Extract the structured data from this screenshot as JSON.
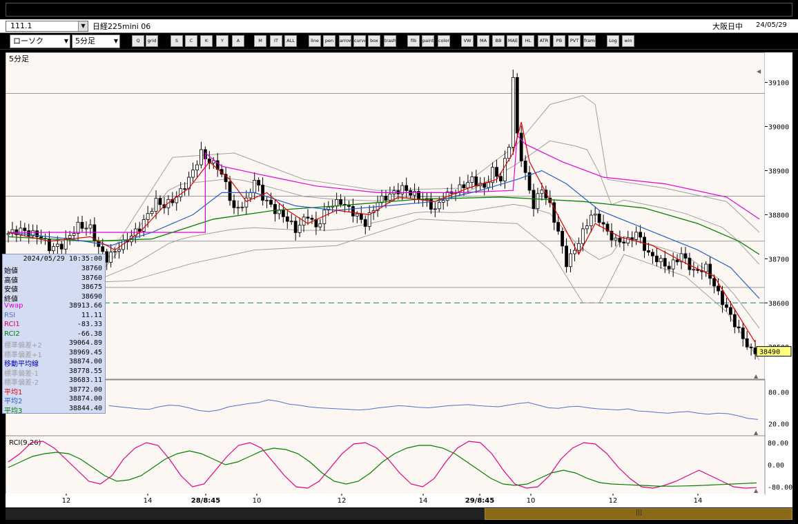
{
  "header": {
    "symbol_code": "111.1",
    "instrument_name": "日経225mini 06",
    "session": "大阪日中",
    "date": "24/05/29"
  },
  "toolbar": {
    "chart_type": "ローソク",
    "interval": "5分足",
    "buttons": [
      "Q",
      "grid",
      "S",
      "C",
      "K",
      "Y",
      "A",
      "M",
      "IT",
      "ALL",
      "line",
      "pen",
      "arrow",
      "curve",
      "box",
      "trash",
      "fib",
      "paint",
      "color",
      "VW",
      "MA",
      "BB",
      "MAE",
      "HL",
      "ATR",
      "PB",
      "PVT",
      "frame",
      "Log",
      "win"
    ]
  },
  "main_panel": {
    "interval_label": "5分足",
    "price_levels": [
      "39100",
      "39000",
      "38900",
      "38800",
      "38700",
      "38600",
      "38500"
    ],
    "last_price_badge": "38490"
  },
  "info_box": {
    "timestamp": "2024/05/29  10:35:00",
    "rows": [
      {
        "label": "始値",
        "value": "38760",
        "color": "#000"
      },
      {
        "label": "高値",
        "value": "38760",
        "color": "#000"
      },
      {
        "label": "安値",
        "value": "38675",
        "color": "#000"
      },
      {
        "label": "終値",
        "value": "38690",
        "color": "#000"
      },
      {
        "label": "Vwap",
        "value": "38913.66",
        "color": "#e000e0"
      },
      {
        "label": "RSI",
        "value": "11.11",
        "color": "#5070d0"
      },
      {
        "label": "RCI1",
        "value": "-83.33",
        "color": "#e00060"
      },
      {
        "label": "RCI2",
        "value": "-66.38",
        "color": "#008000"
      },
      {
        "label": "標準偏差+2",
        "value": "39064.89",
        "color": "#a0a0a0"
      },
      {
        "label": "標準偏差+1",
        "value": "38969.45",
        "color": "#a0a0a0"
      },
      {
        "label": "移動平均線",
        "value": "38874.00",
        "color": "#0000c0"
      },
      {
        "label": "標準偏差-1",
        "value": "38778.55",
        "color": "#a0a0a0"
      },
      {
        "label": "標準偏差-2",
        "value": "38683.11",
        "color": "#a0a0a0"
      },
      {
        "label": "平均1",
        "value": "38772.00",
        "color": "#e00000"
      },
      {
        "label": "平均2",
        "value": "38874.00",
        "color": "#2060d0"
      },
      {
        "label": "平均3",
        "value": "38844.40",
        "color": "#008000"
      }
    ]
  },
  "rsi_panel": {
    "levels": [
      "80.00",
      "20.00"
    ]
  },
  "rci_panel": {
    "label": "RCI(9,26)",
    "levels": [
      "80.00",
      "0.00",
      "-80.00"
    ]
  },
  "x_axis": [
    "12",
    "14",
    "28/8:45",
    "10",
    "12",
    "14",
    "29/8:45",
    "10",
    "12",
    "14"
  ],
  "colors": {
    "background": "#fdf7f3",
    "candle_up": "#ffffff",
    "candle_down": "#000000",
    "ma_short": "#e00000",
    "ma_mid": "#2060d0",
    "ma_long": "#008000",
    "vwap": "#e000e0",
    "bands": "#a0a0a0",
    "rci_fast": "#e00080",
    "rci_slow": "#008000",
    "rsi": "#5070d0"
  },
  "chart_data": {
    "type": "candlestick",
    "title": "",
    "ylim": [
      38430,
      39165
    ],
    "yticks": [
      39100,
      39000,
      38900,
      38800,
      38700,
      38600,
      38500
    ],
    "dashed_level": 38600,
    "last_price": 38490,
    "close_path": [
      {
        "x": 0,
        "y": 38755
      },
      {
        "x": 4,
        "y": 38765
      },
      {
        "x": 9,
        "y": 38750
      },
      {
        "x": 11,
        "y": 38725
      },
      {
        "x": 14,
        "y": 38730
      },
      {
        "x": 18,
        "y": 38775
      },
      {
        "x": 21,
        "y": 38770
      },
      {
        "x": 23,
        "y": 38725
      },
      {
        "x": 25,
        "y": 38700
      },
      {
        "x": 29,
        "y": 38735
      },
      {
        "x": 33,
        "y": 38770
      },
      {
        "x": 37,
        "y": 38830
      },
      {
        "x": 39,
        "y": 38820
      },
      {
        "x": 42,
        "y": 38840
      },
      {
        "x": 45,
        "y": 38880
      },
      {
        "x": 48,
        "y": 38940
      },
      {
        "x": 50,
        "y": 38920
      },
      {
        "x": 52,
        "y": 38910
      },
      {
        "x": 54,
        "y": 38870
      },
      {
        "x": 56,
        "y": 38810
      },
      {
        "x": 59,
        "y": 38830
      },
      {
        "x": 61,
        "y": 38880
      },
      {
        "x": 63,
        "y": 38840
      },
      {
        "x": 66,
        "y": 38810
      },
      {
        "x": 69,
        "y": 38790
      },
      {
        "x": 71,
        "y": 38765
      },
      {
        "x": 74,
        "y": 38800
      },
      {
        "x": 76,
        "y": 38770
      },
      {
        "x": 79,
        "y": 38820
      },
      {
        "x": 82,
        "y": 38830
      },
      {
        "x": 85,
        "y": 38805
      },
      {
        "x": 88,
        "y": 38780
      },
      {
        "x": 91,
        "y": 38830
      },
      {
        "x": 94,
        "y": 38845
      },
      {
        "x": 97,
        "y": 38860
      },
      {
        "x": 100,
        "y": 38845
      },
      {
        "x": 103,
        "y": 38830
      },
      {
        "x": 105,
        "y": 38810
      },
      {
        "x": 107,
        "y": 38840
      },
      {
        "x": 111,
        "y": 38860
      },
      {
        "x": 114,
        "y": 38880
      },
      {
        "x": 117,
        "y": 38860
      },
      {
        "x": 119,
        "y": 38900
      },
      {
        "x": 121,
        "y": 38880
      },
      {
        "x": 123,
        "y": 38960
      },
      {
        "x": 124,
        "y": 39110
      },
      {
        "x": 125,
        "y": 38980
      },
      {
        "x": 126,
        "y": 38930
      },
      {
        "x": 127,
        "y": 38890
      },
      {
        "x": 129,
        "y": 38820
      },
      {
        "x": 131,
        "y": 38860
      },
      {
        "x": 133,
        "y": 38820
      },
      {
        "x": 135,
        "y": 38760
      },
      {
        "x": 137,
        "y": 38690
      },
      {
        "x": 139,
        "y": 38720
      },
      {
        "x": 141,
        "y": 38760
      },
      {
        "x": 143,
        "y": 38800
      },
      {
        "x": 145,
        "y": 38790
      },
      {
        "x": 147,
        "y": 38760
      },
      {
        "x": 149,
        "y": 38740
      },
      {
        "x": 152,
        "y": 38740
      },
      {
        "x": 154,
        "y": 38760
      },
      {
        "x": 157,
        "y": 38710
      },
      {
        "x": 159,
        "y": 38700
      },
      {
        "x": 162,
        "y": 38680
      },
      {
        "x": 165,
        "y": 38710
      },
      {
        "x": 168,
        "y": 38670
      },
      {
        "x": 171,
        "y": 38680
      },
      {
        "x": 174,
        "y": 38620
      },
      {
        "x": 177,
        "y": 38570
      },
      {
        "x": 180,
        "y": 38520
      },
      {
        "x": 182,
        "y": 38490
      }
    ],
    "ma_short": [
      {
        "x": 0,
        "y": 38760
      },
      {
        "x": 10,
        "y": 38740
      },
      {
        "x": 20,
        "y": 38750
      },
      {
        "x": 26,
        "y": 38720
      },
      {
        "x": 32,
        "y": 38760
      },
      {
        "x": 38,
        "y": 38820
      },
      {
        "x": 44,
        "y": 38860
      },
      {
        "x": 49,
        "y": 38920
      },
      {
        "x": 54,
        "y": 38880
      },
      {
        "x": 58,
        "y": 38830
      },
      {
        "x": 63,
        "y": 38850
      },
      {
        "x": 68,
        "y": 38810
      },
      {
        "x": 73,
        "y": 38780
      },
      {
        "x": 80,
        "y": 38810
      },
      {
        "x": 88,
        "y": 38800
      },
      {
        "x": 95,
        "y": 38840
      },
      {
        "x": 104,
        "y": 38830
      },
      {
        "x": 112,
        "y": 38860
      },
      {
        "x": 119,
        "y": 38880
      },
      {
        "x": 123,
        "y": 38940
      },
      {
        "x": 125,
        "y": 39010
      },
      {
        "x": 127,
        "y": 38920
      },
      {
        "x": 131,
        "y": 38850
      },
      {
        "x": 135,
        "y": 38780
      },
      {
        "x": 139,
        "y": 38710
      },
      {
        "x": 143,
        "y": 38780
      },
      {
        "x": 149,
        "y": 38750
      },
      {
        "x": 157,
        "y": 38730
      },
      {
        "x": 165,
        "y": 38690
      },
      {
        "x": 172,
        "y": 38660
      },
      {
        "x": 178,
        "y": 38570
      },
      {
        "x": 182,
        "y": 38510
      }
    ],
    "ma_mid": [
      {
        "x": 0,
        "y": 38760
      },
      {
        "x": 15,
        "y": 38745
      },
      {
        "x": 25,
        "y": 38730
      },
      {
        "x": 35,
        "y": 38760
      },
      {
        "x": 45,
        "y": 38800
      },
      {
        "x": 52,
        "y": 38850
      },
      {
        "x": 60,
        "y": 38850
      },
      {
        "x": 70,
        "y": 38820
      },
      {
        "x": 80,
        "y": 38810
      },
      {
        "x": 92,
        "y": 38820
      },
      {
        "x": 104,
        "y": 38830
      },
      {
        "x": 115,
        "y": 38855
      },
      {
        "x": 124,
        "y": 38880
      },
      {
        "x": 130,
        "y": 38900
      },
      {
        "x": 136,
        "y": 38870
      },
      {
        "x": 144,
        "y": 38810
      },
      {
        "x": 152,
        "y": 38780
      },
      {
        "x": 160,
        "y": 38750
      },
      {
        "x": 168,
        "y": 38720
      },
      {
        "x": 176,
        "y": 38680
      },
      {
        "x": 183,
        "y": 38610
      }
    ],
    "ma_long": [
      {
        "x": 0,
        "y": 38750
      },
      {
        "x": 20,
        "y": 38740
      },
      {
        "x": 35,
        "y": 38745
      },
      {
        "x": 50,
        "y": 38790
      },
      {
        "x": 65,
        "y": 38810
      },
      {
        "x": 80,
        "y": 38820
      },
      {
        "x": 100,
        "y": 38835
      },
      {
        "x": 120,
        "y": 38840
      },
      {
        "x": 140,
        "y": 38830
      },
      {
        "x": 155,
        "y": 38815
      },
      {
        "x": 168,
        "y": 38780
      },
      {
        "x": 178,
        "y": 38740
      },
      {
        "x": 183,
        "y": 38710
      }
    ],
    "vwap": [
      {
        "x": 0,
        "y": 38760
      },
      {
        "x": 48,
        "y": 38760
      },
      {
        "x": 48,
        "y": 38940
      },
      {
        "x": 52,
        "y": 38910
      },
      {
        "x": 62,
        "y": 38890
      },
      {
        "x": 75,
        "y": 38865
      },
      {
        "x": 90,
        "y": 38850
      },
      {
        "x": 110,
        "y": 38850
      },
      {
        "x": 123,
        "y": 38855
      },
      {
        "x": 124,
        "y": 38980
      },
      {
        "x": 126,
        "y": 38960
      },
      {
        "x": 135,
        "y": 38920
      },
      {
        "x": 145,
        "y": 38885
      },
      {
        "x": 160,
        "y": 38870
      },
      {
        "x": 175,
        "y": 38840
      },
      {
        "x": 183,
        "y": 38790
      }
    ],
    "band_upper2": [
      {
        "x": 0,
        "y": 38640
      },
      {
        "x": 20,
        "y": 38640
      },
      {
        "x": 40,
        "y": 38930
      },
      {
        "x": 55,
        "y": 38940
      },
      {
        "x": 72,
        "y": 38880
      },
      {
        "x": 90,
        "y": 38855
      },
      {
        "x": 110,
        "y": 38860
      },
      {
        "x": 124,
        "y": 38960
      },
      {
        "x": 132,
        "y": 39050
      },
      {
        "x": 140,
        "y": 39070
      },
      {
        "x": 143,
        "y": 39050
      },
      {
        "x": 146,
        "y": 38880
      },
      {
        "x": 160,
        "y": 38860
      },
      {
        "x": 175,
        "y": 38830
      },
      {
        "x": 183,
        "y": 38760
      }
    ],
    "band_lower2": [
      {
        "x": 0,
        "y": 38640
      },
      {
        "x": 30,
        "y": 38650
      },
      {
        "x": 45,
        "y": 38690
      },
      {
        "x": 60,
        "y": 38720
      },
      {
        "x": 80,
        "y": 38730
      },
      {
        "x": 100,
        "y": 38790
      },
      {
        "x": 124,
        "y": 38780
      },
      {
        "x": 132,
        "y": 38720
      },
      {
        "x": 140,
        "y": 38600
      },
      {
        "x": 144,
        "y": 38600
      },
      {
        "x": 150,
        "y": 38710
      },
      {
        "x": 165,
        "y": 38660
      },
      {
        "x": 175,
        "y": 38580
      },
      {
        "x": 183,
        "y": 38470
      }
    ],
    "candles_count": 183
  },
  "rsi_values": [
    54,
    52,
    50,
    48,
    47,
    52,
    55,
    54,
    50,
    45,
    43,
    46,
    52,
    55,
    58,
    60,
    65,
    62,
    57,
    55,
    52,
    50,
    49,
    48,
    47,
    46,
    47,
    50,
    52,
    54,
    53,
    51,
    50,
    52,
    54,
    55,
    56,
    54,
    53,
    52,
    55,
    58,
    60,
    55,
    50,
    49,
    52,
    53,
    50,
    48,
    47,
    46,
    48,
    44,
    43,
    41,
    40,
    42,
    43,
    40,
    38,
    40,
    39,
    35,
    30,
    28
  ],
  "rci_fast": [
    10,
    40,
    80,
    85,
    60,
    20,
    -20,
    -60,
    -70,
    -40,
    20,
    60,
    80,
    70,
    20,
    -40,
    -80,
    -70,
    -20,
    30,
    70,
    80,
    60,
    10,
    -40,
    -80,
    -85,
    -60,
    -10,
    40,
    75,
    80,
    60,
    20,
    -30,
    -70,
    -80,
    -50,
    10,
    60,
    85,
    80,
    40,
    -20,
    -70,
    -85,
    -80,
    -40,
    20,
    60,
    80,
    75,
    40,
    -10,
    -50,
    -80,
    -85,
    -75,
    -60,
    -40,
    -20,
    -40,
    -60,
    -80,
    -85,
    -83
  ],
  "rci_slow": [
    -10,
    10,
    30,
    40,
    45,
    40,
    20,
    -10,
    -40,
    -60,
    -55,
    -40,
    -10,
    20,
    40,
    50,
    40,
    20,
    0,
    10,
    30,
    50,
    60,
    55,
    40,
    10,
    -30,
    -60,
    -70,
    -60,
    -30,
    10,
    40,
    60,
    70,
    70,
    60,
    40,
    10,
    -20,
    -50,
    -70,
    -75,
    -70,
    -50,
    -30,
    -20,
    -30,
    -50,
    -65,
    -70,
    -72,
    -74,
    -76,
    -78,
    -78,
    -77,
    -76,
    -74,
    -72,
    -70,
    -68,
    -66
  ]
}
